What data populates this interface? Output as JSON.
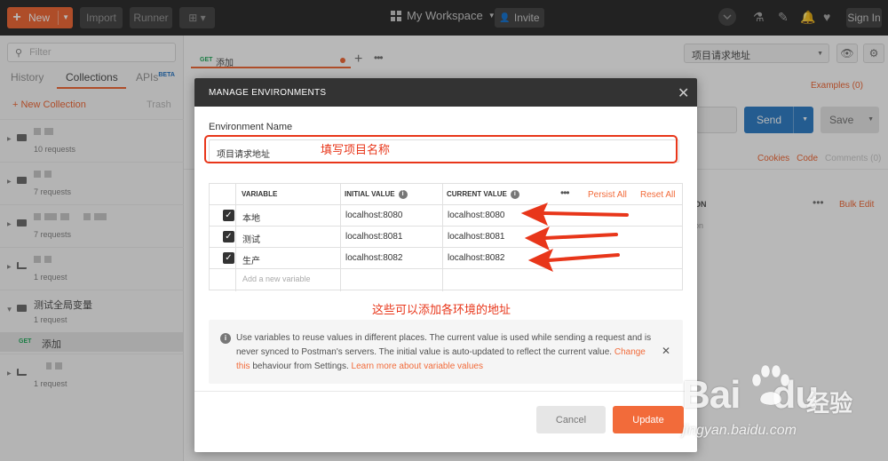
{
  "topbar": {
    "new_label": "New",
    "import_label": "Import",
    "runner_label": "Runner",
    "workspace_label": "My Workspace",
    "invite_label": "Invite",
    "signin_label": "Sign In"
  },
  "sidebar": {
    "filter_placeholder": "Filter",
    "tabs": [
      "History",
      "Collections",
      "APIs"
    ],
    "beta": "BETA",
    "new_collection": "+ New Collection",
    "trash": "Trash",
    "collections": [
      {
        "name": "",
        "count": "10 requests"
      },
      {
        "name": "",
        "count": "7 requests"
      },
      {
        "name": "",
        "count": "7 requests"
      },
      {
        "name": "",
        "count": "1 request"
      },
      {
        "name": "测试全局变量",
        "count": "1 request"
      },
      {
        "name": "",
        "count": "1 request"
      }
    ],
    "request": {
      "method": "GET",
      "name": "添加"
    }
  },
  "main": {
    "tab": {
      "method": "GET",
      "name": "添加"
    },
    "env_selected": "项目请求地址",
    "examples": "Examples (0)",
    "send_label": "Send",
    "save_label": "Save",
    "cookies": "Cookies",
    "code": "Code",
    "comments": "Comments (0)",
    "bulk_edit": "Bulk Edit",
    "col_fragment": "ON",
    "desc_fragment": "on"
  },
  "modal": {
    "title": "MANAGE ENVIRONMENTS",
    "env_name_label": "Environment Name",
    "env_name_value": "项目请求地址",
    "annotation_name": "填写项目名称",
    "annotation_vars": "这些可以添加各环境的地址",
    "headers": {
      "variable": "VARIABLE",
      "initial_value": "INITIAL VALUE",
      "current_value": "CURRENT VALUE",
      "persist_all": "Persist All",
      "reset_all": "Reset All"
    },
    "rows": [
      {
        "checked": true,
        "variable": "本地",
        "initial": "localhost:8080",
        "current": "localhost:8080"
      },
      {
        "checked": true,
        "variable": "测试",
        "initial": "localhost:8081",
        "current": "localhost:8081"
      },
      {
        "checked": true,
        "variable": "生产",
        "initial": "localhost:8082",
        "current": "localhost:8082"
      }
    ],
    "add_placeholder": "Add a new variable",
    "info": {
      "text1": "Use variables to reuse values in different places. The current value is used while sending a request and is never synced to Postman's servers. The initial value is auto-updated to reflect the current value. ",
      "link1": "Change this",
      "text2": " behaviour from Settings. ",
      "link2": "Learn more about variable values"
    },
    "cancel_label": "Cancel",
    "update_label": "Update"
  },
  "watermark": {
    "logo_a": "Bai",
    "logo_b": "du",
    "cn": "经验",
    "url": "jingyan.baidu.com"
  },
  "colors": {
    "accent": "#f26b3a",
    "send_blue": "#3280c8",
    "annotation_red": "#e8361a",
    "topbar": "#303030"
  }
}
